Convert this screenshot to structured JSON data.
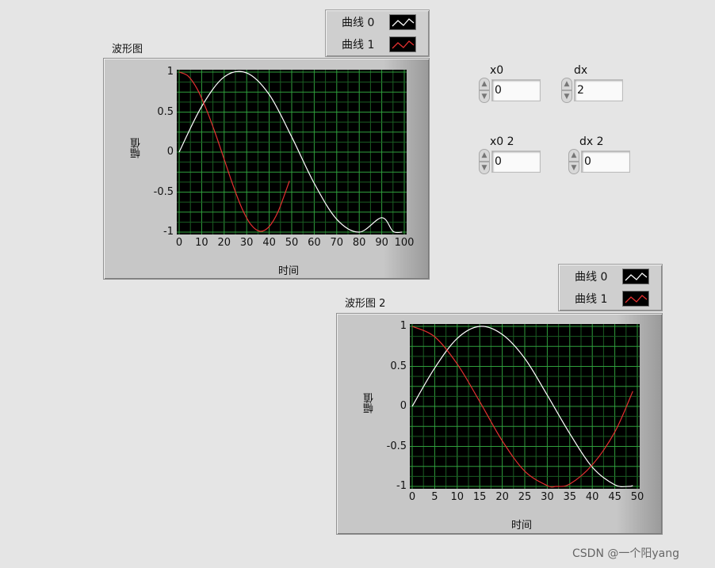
{
  "graphs": [
    {
      "label": "波形图",
      "legend": [
        {
          "name": "曲线 0",
          "color": "#ffffff"
        },
        {
          "name": "曲线 1",
          "color": "#e53030"
        }
      ],
      "x_label": "时间",
      "y_label": "幅值",
      "x_ticks": [
        "0",
        "10",
        "20",
        "30",
        "40",
        "50",
        "60",
        "70",
        "80",
        "90",
        "100"
      ],
      "y_ticks": [
        "1",
        "0.5",
        "0",
        "-0.5",
        "-1"
      ]
    },
    {
      "label": "波形图 2",
      "legend": [
        {
          "name": "曲线 0",
          "color": "#ffffff"
        },
        {
          "name": "曲线 1",
          "color": "#e53030"
        }
      ],
      "x_label": "时间",
      "y_label": "幅值",
      "x_ticks": [
        "0",
        "5",
        "10",
        "15",
        "20",
        "25",
        "30",
        "35",
        "40",
        "45",
        "50"
      ],
      "y_ticks": [
        "1",
        "0.5",
        "0",
        "-0.5",
        "-1"
      ]
    }
  ],
  "controls": {
    "x0": {
      "label": "x0",
      "value": "0"
    },
    "dx": {
      "label": "dx",
      "value": "2"
    },
    "x0_2": {
      "label": "x0 2",
      "value": "0"
    },
    "dx_2": {
      "label": "dx 2",
      "value": "0"
    }
  },
  "watermark": "CSDN @一个阳yang",
  "chart_data": [
    {
      "type": "line",
      "title": "波形图",
      "xlabel": "时间",
      "ylabel": "幅值",
      "xlim": [
        0,
        100
      ],
      "ylim": [
        -1,
        1
      ],
      "grid": true,
      "legend_position": "top-right",
      "series": [
        {
          "name": "曲线 0",
          "color": "#ffffff",
          "x": [
            0,
            10,
            20,
            30,
            40,
            50,
            60,
            70,
            80,
            90,
            95,
            99
          ],
          "y": [
            0,
            0.57,
            0.94,
            0.99,
            0.72,
            0.19,
            -0.39,
            -0.84,
            -1.0,
            -0.82,
            -0.99,
            -1.0
          ]
        },
        {
          "name": "曲线 1",
          "color": "#e53030",
          "x": [
            0,
            4,
            8,
            12,
            16,
            20,
            24,
            28,
            32,
            36,
            40,
            44,
            49
          ],
          "y": [
            1.0,
            0.95,
            0.79,
            0.54,
            0.24,
            -0.09,
            -0.42,
            -0.71,
            -0.91,
            -0.99,
            -0.93,
            -0.74,
            -0.36
          ]
        }
      ]
    },
    {
      "type": "line",
      "title": "波形图 2",
      "xlabel": "时间",
      "ylabel": "幅值",
      "xlim": [
        0,
        50
      ],
      "ylim": [
        -1,
        1
      ],
      "grid": true,
      "legend_position": "top-right",
      "series": [
        {
          "name": "曲线 0",
          "color": "#ffffff",
          "x": [
            0,
            5,
            10,
            15,
            20,
            25,
            30,
            35,
            40,
            45,
            48,
            49
          ],
          "y": [
            0,
            0.48,
            0.85,
            1.0,
            0.9,
            0.6,
            0.14,
            -0.34,
            -0.76,
            -0.98,
            -1.0,
            -0.99
          ]
        },
        {
          "name": "曲线 1",
          "color": "#e53030",
          "x": [
            0,
            5,
            10,
            15,
            20,
            25,
            30,
            32,
            35,
            40,
            45,
            49
          ],
          "y": [
            1.0,
            0.87,
            0.53,
            0.06,
            -0.43,
            -0.81,
            -0.99,
            -1.0,
            -0.97,
            -0.73,
            -0.32,
            0.19
          ]
        }
      ]
    }
  ]
}
